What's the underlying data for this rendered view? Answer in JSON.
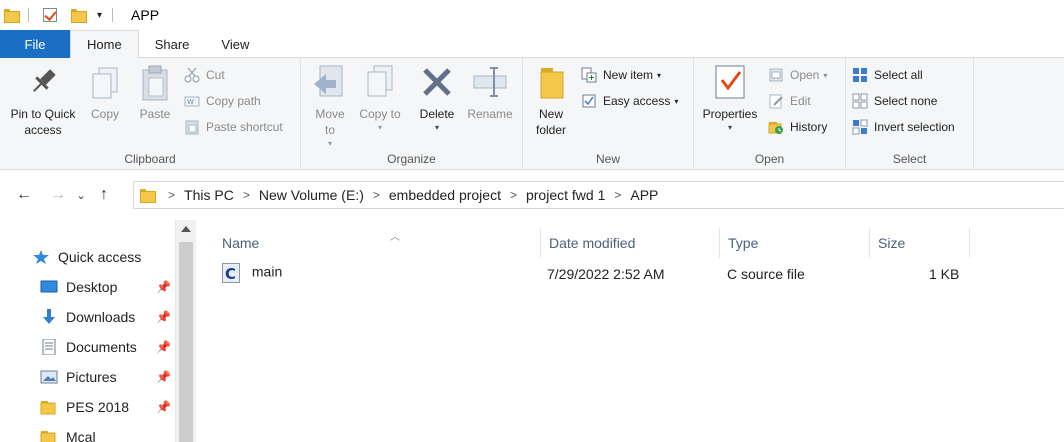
{
  "window": {
    "title": "APP"
  },
  "tabs": [
    "File",
    "Home",
    "Share",
    "View"
  ],
  "ribbon": {
    "clipboard": {
      "label": "Clipboard",
      "pin": "Pin to Quick access",
      "copy": "Copy",
      "paste": "Paste",
      "cut": "Cut",
      "copy_path": "Copy path",
      "paste_shortcut": "Paste shortcut"
    },
    "organize": {
      "label": "Organize",
      "move_to": "Move to",
      "copy_to": "Copy to",
      "delete": "Delete",
      "rename": "Rename"
    },
    "new": {
      "label": "New",
      "new_folder": "New folder",
      "new_item": "New item",
      "easy_access": "Easy access"
    },
    "open": {
      "label": "Open",
      "properties": "Properties",
      "open": "Open",
      "edit": "Edit",
      "history": "History"
    },
    "select": {
      "label": "Select",
      "select_all": "Select all",
      "select_none": "Select none",
      "invert_selection": "Invert selection"
    }
  },
  "breadcrumb": [
    "This PC",
    "New Volume (E:)",
    "embedded project",
    "project fwd 1",
    "APP"
  ],
  "nav_pane": {
    "quick_access": "Quick access",
    "items": [
      {
        "label": "Desktop",
        "icon": "desktop-icon",
        "pinned": true
      },
      {
        "label": "Downloads",
        "icon": "downloads-icon",
        "pinned": true
      },
      {
        "label": "Documents",
        "icon": "documents-icon",
        "pinned": true
      },
      {
        "label": "Pictures",
        "icon": "pictures-icon",
        "pinned": true
      },
      {
        "label": "PES 2018",
        "icon": "folder-icon",
        "pinned": true
      },
      {
        "label": "Mcal",
        "icon": "folder-icon",
        "pinned": false
      }
    ]
  },
  "columns": {
    "name": "Name",
    "date": "Date modified",
    "type": "Type",
    "size": "Size"
  },
  "files": [
    {
      "name": "main",
      "date": "7/29/2022 2:52 AM",
      "type": "C source file",
      "size": "1 KB"
    }
  ],
  "colors": {
    "file_tab": "#1a6fc4",
    "ribbon_bg": "#f5f6f7",
    "header_text": "#4c607a",
    "folder": "#f3c84a"
  }
}
